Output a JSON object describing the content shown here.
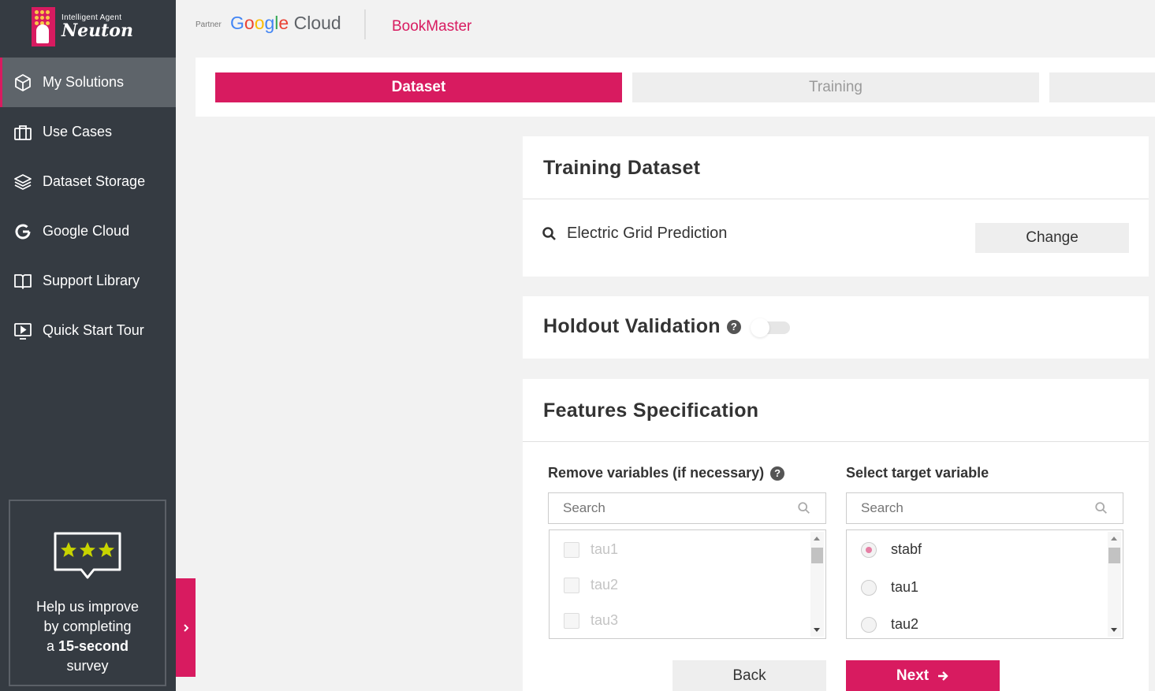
{
  "brand": {
    "tagline": "Intelligent Agent",
    "name": "Neuton",
    "accent_color": "#d81b60",
    "sidebar_bg": "#353b42"
  },
  "sidebar": {
    "items": [
      {
        "label": "My Solutions",
        "icon": "cube-icon",
        "active": true
      },
      {
        "label": "Use Cases",
        "icon": "briefcase-icon",
        "active": false
      },
      {
        "label": "Dataset Storage",
        "icon": "layers-icon",
        "active": false
      },
      {
        "label": "Google Cloud",
        "icon": "google-g-icon",
        "active": false
      },
      {
        "label": "Support Library",
        "icon": "book-icon",
        "active": false
      },
      {
        "label": "Quick Start Tour",
        "icon": "play-screen-icon",
        "active": false
      }
    ],
    "survey": {
      "line1": "Help us improve",
      "line2": "by completing",
      "line3_prefix": "a ",
      "line3_bold": "15-second",
      "line4": "survey",
      "icon": "rating-stars-icon"
    },
    "expand_icon": "chevron-right-icon"
  },
  "header": {
    "partner_label": "Partner",
    "google": {
      "g1": "G",
      "g2": "o",
      "g3": "o",
      "g4": "g",
      "g5": "l",
      "g6": "e",
      "cloud": " Cloud"
    },
    "app_name": "BookMaster"
  },
  "steps": {
    "items": [
      {
        "label": "Dataset",
        "active": true
      },
      {
        "label": "Training",
        "active": false
      },
      {
        "label": "",
        "active": false
      }
    ]
  },
  "training_dataset": {
    "title": "Training Dataset",
    "dataset_name": "Electric Grid Prediction",
    "change_label": "Change",
    "icon": "search-icon"
  },
  "holdout": {
    "title": "Holdout Validation",
    "help_icon": "question-icon",
    "enabled": false
  },
  "features": {
    "title": "Features Specification",
    "remove_label": "Remove variables (if necessary)",
    "target_label": "Select target variable",
    "search_placeholder": "Search",
    "remove_items": [
      "tau1",
      "tau2",
      "tau3"
    ],
    "target_items": [
      "stabf",
      "tau1",
      "tau2"
    ],
    "target_selected": "stabf",
    "back_label": "Back",
    "next_label": "Next"
  }
}
